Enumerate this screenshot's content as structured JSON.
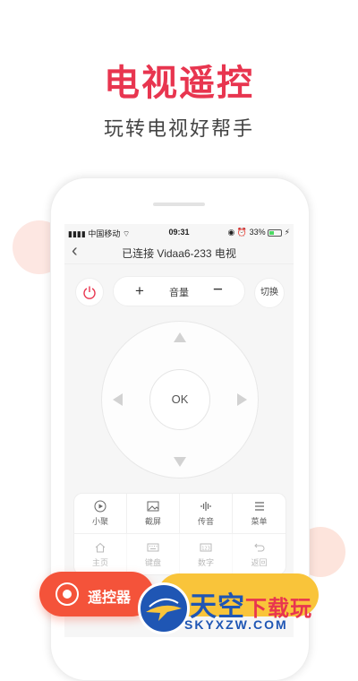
{
  "promo": {
    "title": "电视遥控",
    "subtitle": "玩转电视好帮手"
  },
  "status_bar": {
    "carrier": "中国移动",
    "time": "09:31",
    "battery": "33%"
  },
  "nav": {
    "title": "已连接 Vidaa6-233 电视"
  },
  "controls": {
    "volume_plus": "+",
    "volume_label": "音量",
    "volume_minus": "−",
    "switch_label": "切换",
    "ok_label": "OK"
  },
  "grid": [
    {
      "label": "小聚",
      "icon": "play-icon"
    },
    {
      "label": "截屏",
      "icon": "image-icon"
    },
    {
      "label": "传音",
      "icon": "sound-wave-icon"
    },
    {
      "label": "菜单",
      "icon": "menu-icon"
    },
    {
      "label": "主页",
      "icon": "home-icon"
    },
    {
      "label": "键盘",
      "icon": "keyboard-icon"
    },
    {
      "label": "数字",
      "icon": "number-icon"
    },
    {
      "label": "返回",
      "icon": "return-icon"
    }
  ],
  "bottom": {
    "remote_label": "遥控器"
  },
  "watermark": {
    "main": "天空",
    "accent": "下载玩",
    "sub": "SKYXZW.COM"
  },
  "colors": {
    "accent": "#e8354f",
    "button": "#f4533a",
    "yellow": "#f9c43a",
    "watermark_blue": "#1f56b4"
  }
}
